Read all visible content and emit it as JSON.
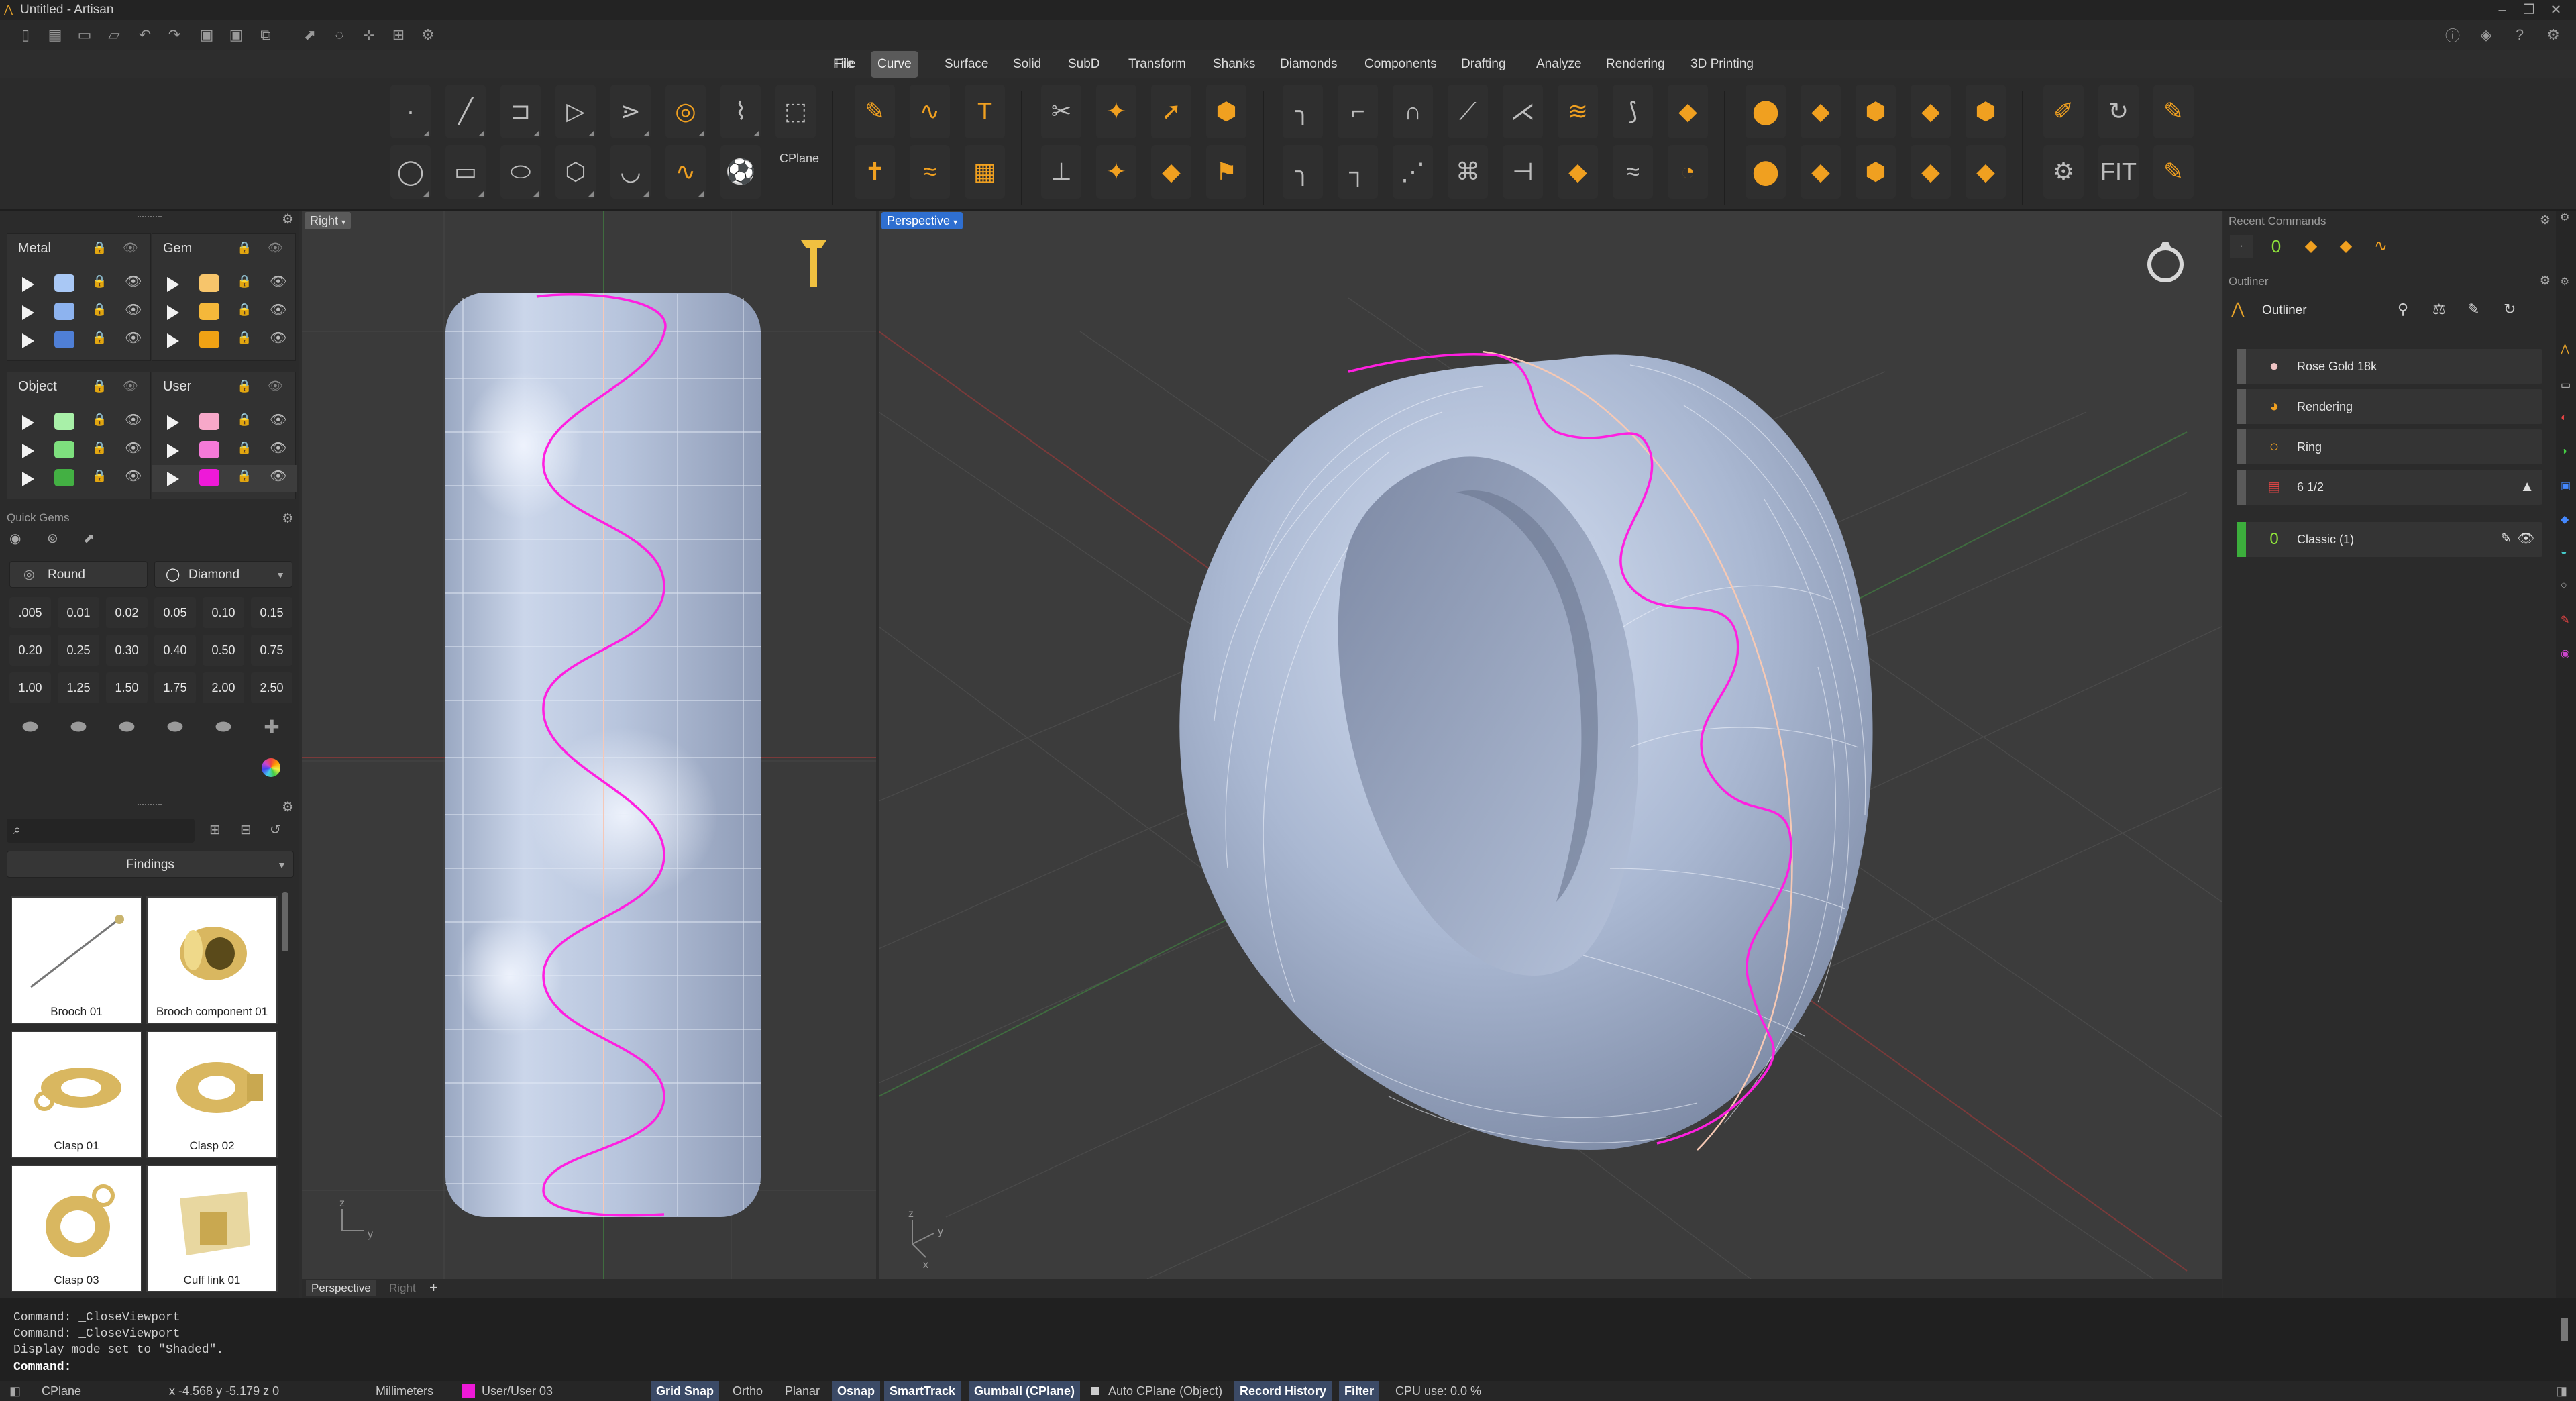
{
  "window": {
    "title": "Untitled - Artisan",
    "controls": [
      "–",
      "❐",
      "✕"
    ]
  },
  "menu": {
    "items": [
      "File",
      "Curve",
      "Surface",
      "Solid",
      "SubD",
      "Transform",
      "Shanks",
      "Diamonds",
      "Components",
      "Drafting",
      "Analyze",
      "Rendering",
      "3D Printing"
    ],
    "active": "Curve"
  },
  "ribbon": {
    "cplane_label": "CPlane"
  },
  "layers": {
    "metal": {
      "name": "Metal",
      "colors": [
        "#a9c8f5",
        "#8db3ef",
        "#4f7fd6"
      ]
    },
    "gem": {
      "name": "Gem",
      "colors": [
        "#f7c56b",
        "#f5b83a",
        "#f0a214"
      ]
    },
    "object": {
      "name": "Object",
      "colors": [
        "#a8f0a8",
        "#7ee07e",
        "#43b043"
      ]
    },
    "user": {
      "name": "User",
      "colors": [
        "#f7a8c9",
        "#f57ad8",
        "#ee19d8"
      ]
    }
  },
  "quick_gems": {
    "title": "Quick Gems",
    "cut": "Round",
    "material": "Diamond",
    "sizes": [
      ".005",
      "0.01",
      "0.02",
      "0.05",
      "0.10",
      "0.15",
      "0.20",
      "0.25",
      "0.30",
      "0.40",
      "0.50",
      "0.75",
      "1.00",
      "1.25",
      "1.50",
      "1.75",
      "2.00",
      "2.50"
    ]
  },
  "library": {
    "category": "Findings",
    "items": [
      "Brooch 01",
      "Brooch component 01",
      "Clasp 01",
      "Clasp 02",
      "Clasp 03",
      "Cuff link 01"
    ]
  },
  "viewports": {
    "right_label": "Right",
    "perspective_label": "Perspective",
    "tabs": [
      "Perspective",
      "Right"
    ],
    "add_tab": "+",
    "axis_right": {
      "z": "z",
      "y": "y"
    },
    "axis_persp": {
      "z": "z",
      "y": "y",
      "x": "x"
    }
  },
  "recent_commands": {
    "title": "Recent Commands"
  },
  "outliner": {
    "panel_title": "Outliner",
    "header": "Outliner",
    "rows": [
      "Rose Gold 18k",
      "Rendering",
      "Ring",
      "6 1/2",
      "Classic (1)"
    ]
  },
  "command_history": [
    "Command: _CloseViewport",
    "Command: _CloseViewport",
    "Display mode set to \"Shaded\"."
  ],
  "command_prompt": "Command:",
  "status": {
    "cplane": "CPlane",
    "coords": "x -4.568  y -5.179  z 0",
    "units": "Millimeters",
    "layer": "User/User 03",
    "layer_color": "#ee19d8",
    "grid_snap": "Grid Snap",
    "ortho": "Ortho",
    "planar": "Planar",
    "osnap": "Osnap",
    "smarttrack": "SmartTrack",
    "gumball": "Gumball (CPlane)",
    "auto_cplane": "Auto CPlane (Object)",
    "record_history": "Record History",
    "filter": "Filter",
    "cpu": "CPU use: 0.0 %"
  }
}
